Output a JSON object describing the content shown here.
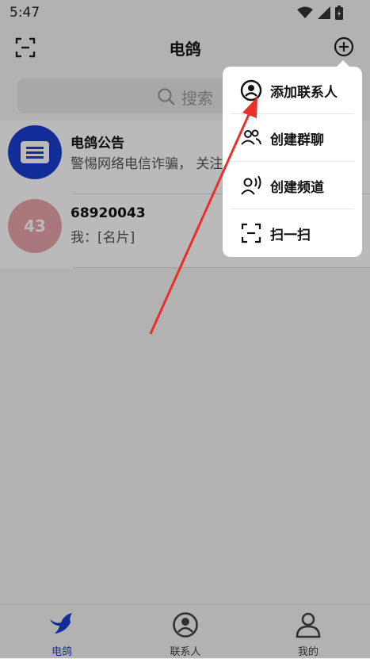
{
  "status_bar": {
    "time": "5:47"
  },
  "header": {
    "title": "电鸽"
  },
  "search": {
    "placeholder": "搜索"
  },
  "conversations": [
    {
      "name": "电鸽公告",
      "preview": "警惕网络电信诈骗， 关注"
    },
    {
      "name": "68920043",
      "preview": "我：[名片]",
      "avatar_text": "43"
    }
  ],
  "menu": {
    "items": [
      {
        "label": "添加联系人",
        "icon": "person-circle-icon"
      },
      {
        "label": "创建群聊",
        "icon": "group-icon"
      },
      {
        "label": "创建频道",
        "icon": "channel-icon"
      },
      {
        "label": "扫一扫",
        "icon": "scan-icon"
      }
    ]
  },
  "tabs": [
    {
      "label": "电鸽",
      "icon": "dove-icon",
      "active": true
    },
    {
      "label": "联系人",
      "icon": "contacts-icon",
      "active": false
    },
    {
      "label": "我的",
      "icon": "profile-icon",
      "active": false
    }
  ],
  "colors": {
    "accent": "#1a3ed1",
    "annotation_arrow": "#e8302a",
    "overlay": "rgba(0,0,0,0.27)"
  }
}
